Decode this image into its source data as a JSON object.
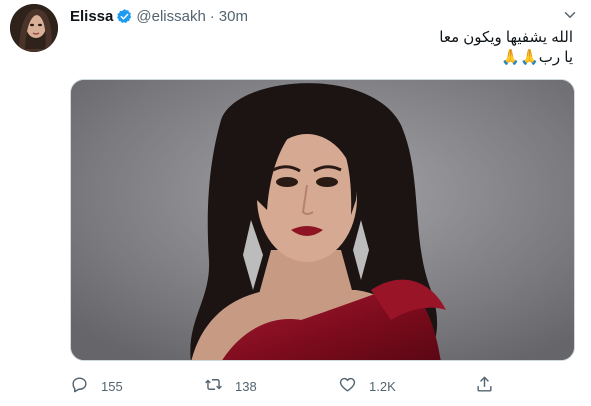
{
  "author": {
    "name": "Elissa",
    "handle": "@elissakh",
    "separator": "·",
    "time": "30m",
    "verified": true
  },
  "tweet": {
    "line1": "الله يشفيها ويكون معا",
    "line2": "يا رب🙏🙏"
  },
  "actions": {
    "replies": "155",
    "retweets": "138",
    "likes": "1.2K"
  },
  "colors": {
    "verified": "#1d9bf0",
    "muted": "#536471",
    "dress": "#8b0f22"
  },
  "icons": {
    "reply": "reply-icon",
    "retweet": "retweet-icon",
    "like": "heart-icon",
    "share": "share-icon",
    "more": "chevron-down-icon"
  }
}
